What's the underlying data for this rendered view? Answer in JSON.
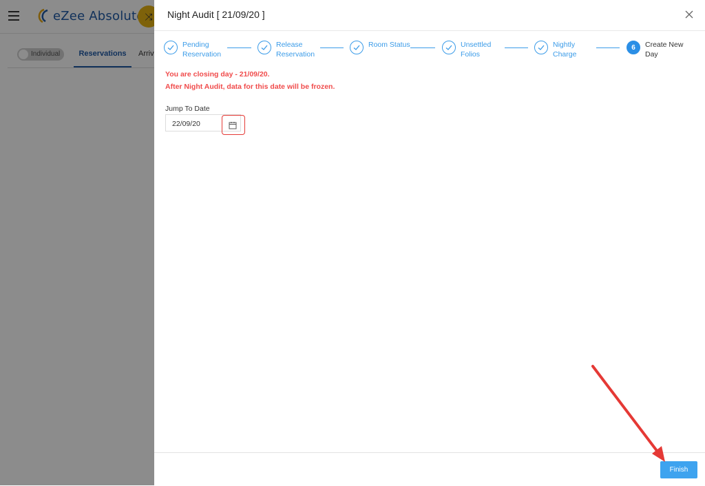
{
  "app": {
    "brand": "eZee Absolute",
    "brand_color": "#1f5aa6"
  },
  "subbar": {
    "toggle_label": "Individual",
    "tabs": [
      "Reservations",
      "Arriv"
    ]
  },
  "drawer": {
    "title": "Night Audit [ 21/09/20 ]",
    "steps": [
      {
        "line1": "Pending",
        "line2": "Reservation",
        "state": "done"
      },
      {
        "line1": "Release",
        "line2": "Reservation",
        "state": "done"
      },
      {
        "line1": "Room Status",
        "line2": "",
        "state": "done"
      },
      {
        "line1": "Unsettled",
        "line2": "Folios",
        "state": "done"
      },
      {
        "line1": "Nightly",
        "line2": "Charge",
        "state": "done"
      },
      {
        "line1": "Create New",
        "line2": "Day",
        "state": "active",
        "number": "6"
      }
    ],
    "warning_line1": "You are closing day - 21/09/20.",
    "warning_line2": "After Night Audit, data for this date will be frozen.",
    "jump_label": "Jump To Date",
    "jump_value": "22/09/20",
    "finish_label": "Finish"
  },
  "colors": {
    "accent": "#3a9be8",
    "warning": "#f04b4b",
    "finish_button": "#3ea3ef",
    "highlight": "#e53935"
  }
}
